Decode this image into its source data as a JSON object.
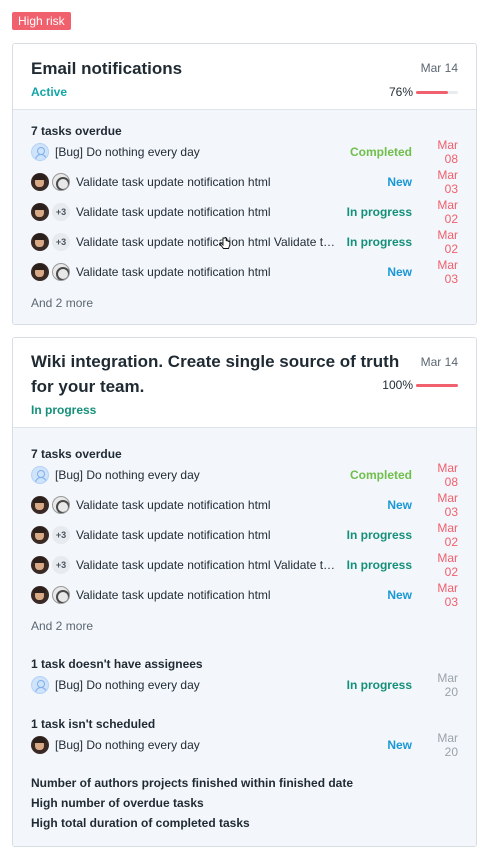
{
  "badge": "High risk",
  "cards": [
    {
      "title_line1": "Email notifications",
      "title_line2": "",
      "status": "Active",
      "date": "Mar 14",
      "progress": {
        "label": "76%",
        "value": 0.76
      },
      "overdue": {
        "title": "7 tasks overdue",
        "tasks": [
          {
            "text": "[Bug] Do nothing every day",
            "status": "Completed",
            "date": "Mar 08"
          },
          {
            "text": "Validate task update notification html",
            "status": "New",
            "date": "Mar 03"
          },
          {
            "text": "Validate task update notification html",
            "extra": "+3",
            "status": "In progress",
            "date": "Mar 02"
          },
          {
            "text": "Validate task update notification html Validate task up...",
            "extra": "+3",
            "status": "In progress",
            "date": "Mar 02"
          },
          {
            "text": "Validate task update notification html",
            "status": "New",
            "date": "Mar 03"
          }
        ],
        "more": "And 2 more"
      }
    },
    {
      "title_line1": "Wiki integration. Create single source of truth",
      "title_line2": "for your team.",
      "status": "In progress",
      "date": "Mar 14",
      "progress": {
        "label": "100%",
        "value": 1.0
      },
      "overdue": {
        "title": "7 tasks overdue",
        "tasks": [
          {
            "text": "[Bug] Do nothing every day",
            "status": "Completed",
            "date": "Mar 08"
          },
          {
            "text": "Validate task update notification html",
            "status": "New",
            "date": "Mar 03"
          },
          {
            "text": "Validate task update notification html",
            "extra": "+3",
            "status": "In progress",
            "date": "Mar 02"
          },
          {
            "text": "Validate task update notification html Validate task up...",
            "extra": "+3",
            "status": "In progress",
            "date": "Mar 02"
          },
          {
            "text": "Validate task update notification html",
            "status": "New",
            "date": "Mar 03"
          }
        ],
        "more": "And 2 more"
      },
      "no_assignees": {
        "title": "1 task doesn't have assignees",
        "task": {
          "text": "[Bug] Do nothing every day",
          "status": "In progress",
          "date": "Mar 20"
        }
      },
      "not_scheduled": {
        "title": "1 task isn't scheduled",
        "task": {
          "text": "[Bug] Do nothing every day",
          "status": "New",
          "date": "Mar 20"
        }
      },
      "flags": [
        "Number of authors projects finished within finished date",
        "High number of overdue tasks",
        "High total duration of completed tasks"
      ]
    }
  ]
}
